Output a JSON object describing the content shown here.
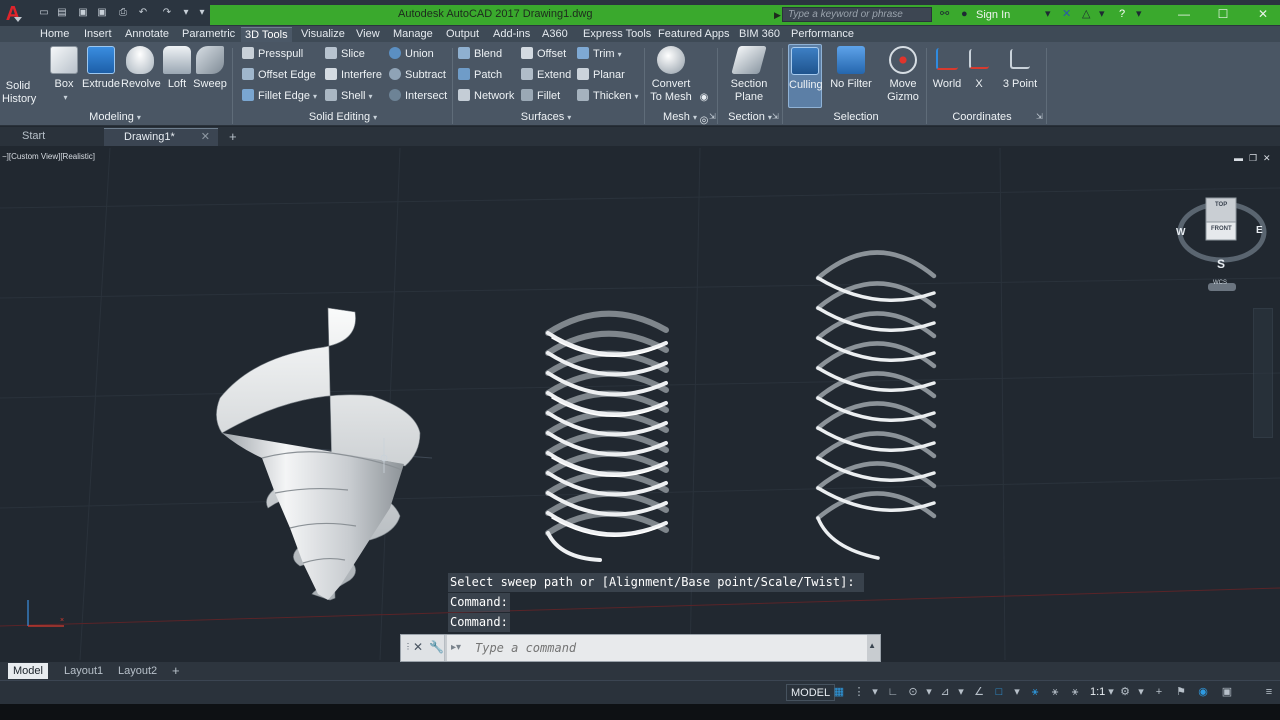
{
  "window": {
    "title": "Autodesk AutoCAD 2017    Drawing1.dwg",
    "search_placeholder": "Type a keyword or phrase",
    "sign_in": "Sign In",
    "accent": "#3aa92d"
  },
  "ribbon_tabs": [
    "Home",
    "Insert",
    "Annotate",
    "Parametric",
    "3D Tools",
    "Visualize",
    "View",
    "Manage",
    "Output",
    "Add-ins",
    "A360",
    "Express Tools",
    "Featured Apps",
    "BIM 360",
    "Performance"
  ],
  "ribbon": {
    "modeling": {
      "solid_history": "Solid History",
      "box": "Box",
      "extrude": "Extrude",
      "revolve": "Revolve",
      "loft": "Loft",
      "sweep": "Sweep",
      "title": "Modeling"
    },
    "solid_editing": {
      "presspull": "Presspull",
      "offset_edge": "Offset Edge",
      "fillet_edge": "Fillet Edge",
      "slice": "Slice",
      "interfere": "Interfere",
      "shell": "Shell",
      "union": "Union",
      "subtract": "Subtract",
      "intersect": "Intersect",
      "title": "Solid Editing"
    },
    "surfaces": {
      "blend": "Blend",
      "patch": "Patch",
      "network": "Network",
      "offset": "Offset",
      "extend": "Extend",
      "fillet": "Fillet",
      "trim": "Trim",
      "planar": "Planar",
      "thicken": "Thicken",
      "title": "Surfaces"
    },
    "mesh": {
      "convert": "Convert To Mesh",
      "title": "Mesh"
    },
    "section": {
      "section_plane": "Section Plane",
      "title": "Section"
    },
    "selection": {
      "culling": "Culling",
      "no_filter": "No Filter",
      "move_gizmo": "Move Gizmo",
      "title": "Selection"
    },
    "coordinates": {
      "world": "World",
      "x": "X",
      "three_point": "3 Point",
      "title": "Coordinates"
    }
  },
  "file_tabs": {
    "start": "Start",
    "drawing": "Drawing1*"
  },
  "viewport": {
    "label": "−][Custom View][Realistic]",
    "viewcube": {
      "top": "TOP",
      "front": "FRONT",
      "west": "W",
      "east": "E",
      "south": "S",
      "wcs": "WCS"
    }
  },
  "command": {
    "history": [
      "Select sweep path or [Alignment/Base point/Scale/Twist]:",
      "Command:",
      "Command:"
    ],
    "placeholder": "Type a command"
  },
  "layout_tabs": [
    "Model",
    "Layout1",
    "Layout2"
  ],
  "status": {
    "model": "MODEL",
    "scale": "1:1"
  },
  "icons": [
    "search-icon",
    "user-icon",
    "help-icon",
    "close-icon",
    "plus-icon",
    "gear-icon"
  ]
}
